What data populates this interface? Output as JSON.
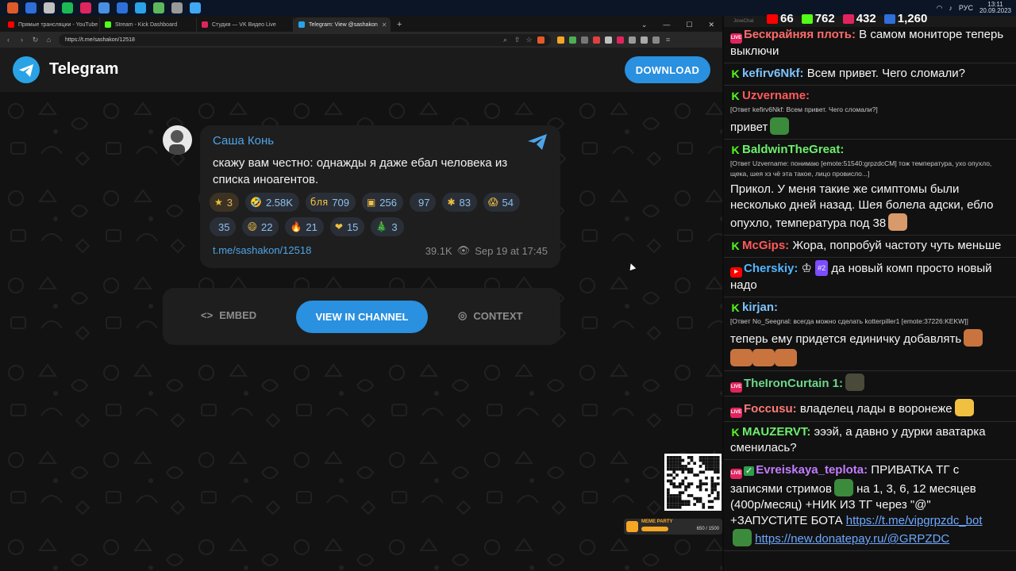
{
  "taskbar": {
    "apps": [
      "#e05a2a",
      "#2e6fd8",
      "#c0c0c0",
      "#1db954",
      "#e0245e",
      "#4a90e2",
      "#2e6fd8",
      "#2aa3e6",
      "#5cb85c",
      "#999999",
      "#3fa9f5"
    ],
    "lang": "РУС",
    "time": "13:11",
    "date": "20.09.2023"
  },
  "browser": {
    "tabs": [
      {
        "label": "Прямые трансляции - YouTube Stu",
        "color": "#ff0000"
      },
      {
        "label": "Stream - Kick Dashboard",
        "color": "#53fc18"
      },
      {
        "label": "Студия — VK Видео Live",
        "color": "#e0245e"
      },
      {
        "label": "Telegram: View @sashakon",
        "color": "#2aa3e6",
        "active": true
      }
    ],
    "new_tab": "+",
    "url": "https://t.me/sashakon/12518"
  },
  "telegram": {
    "brand": "Telegram",
    "download": "DOWNLOAD",
    "post": {
      "author": "Саша Конь",
      "text": "скажу вам честно: однажды я даже ебал человека из списка иноагентов.",
      "reactions": [
        {
          "emoji": "★",
          "count": "3",
          "own": true
        },
        {
          "emoji": "🤣",
          "count": "2.58K"
        },
        {
          "emoji": "бля",
          "count": "709"
        },
        {
          "emoji": "▣",
          "count": "256"
        },
        {
          "emoji": "",
          "count": "97"
        },
        {
          "emoji": "✱",
          "count": "83"
        },
        {
          "emoji": "😱",
          "count": "54"
        },
        {
          "emoji": "",
          "count": "35"
        },
        {
          "emoji": "😄",
          "count": "22"
        },
        {
          "emoji": "🔥",
          "count": "21"
        },
        {
          "emoji": "❤",
          "count": "15"
        },
        {
          "emoji": "🎄",
          "count": "3"
        }
      ],
      "link": "t.me/sashakon/12518",
      "views": "39.1K",
      "date": "Sep 19 at 17:45"
    },
    "actions": {
      "embed": "EMBED",
      "view": "VIEW IN CHANNEL",
      "context": "CONTEXT"
    }
  },
  "overlay": {
    "meme_label": "МЕМЕ PARTY",
    "meme_count": "650 / 1500",
    "meme_progress": 0.43
  },
  "chat": {
    "window_title": "JoveChat",
    "stats": [
      {
        "platform": "youtube",
        "value": "66",
        "color": "#ff0000"
      },
      {
        "platform": "kick",
        "value": "762",
        "color": "#53fc18"
      },
      {
        "platform": "vk",
        "value": "432",
        "color": "#e0245e"
      },
      {
        "platform": "viewers",
        "value": "1,260",
        "color": "#2e6fd8"
      }
    ],
    "messages": [
      {
        "plat": "vk",
        "nick": "Бескрайняя плоть:",
        "color": "#ff6b6b",
        "text": "В самом мониторе теперь выключи"
      },
      {
        "plat": "kick",
        "nick": "kefirv6Nkf:",
        "color": "#7cc4ff",
        "text": "Всем привет. Чего сломали?"
      },
      {
        "plat": "kick",
        "nick": "Uzvername:",
        "color": "#ff5a5a",
        "reply": "[Ответ kefirv6Nkf: Всем привет. Чего сломали?]",
        "text": "привет",
        "emote": "#3c8a3c"
      },
      {
        "plat": "kick",
        "nick": "BaldwinTheGreat:",
        "color": "#6cf06c",
        "reply": "[Ответ Uzvername: понимаю [emote:51540:grpzdcCM] тож температура, ухо опухло, щека, шея хз чё эта такое, лицо провисло...]",
        "text": "Прикол. У меня такие же симптомы были несколько дней назад. Шея болела адски, ебло опухло, температура под 38",
        "emote": "#d89a6a"
      },
      {
        "plat": "kick",
        "nick": "McGips:",
        "color": "#ff5a5a",
        "text": "Жора, попробуй частоту чуть меньше"
      },
      {
        "plat": "yt",
        "nick": "Cherskiy:",
        "color": "#52b6ff",
        "badge": "#2",
        "crown": "♔",
        "text": "да новый комп просто новый надо"
      },
      {
        "plat": "kick",
        "nick": "kirjan:",
        "color": "#7cc4ff",
        "reply": "[Ответ No_Seegnal: всегда можно сделать kotterpiller1 [emote:37226:KEKW]]",
        "text": "теперь ему придется единичку добавлять",
        "emote": "#c9743e",
        "emote_row": 3
      },
      {
        "plat": "vk",
        "nick": "TheIronCurtain 1:",
        "color": "#6cd68a",
        "text": "",
        "emote": "#4a4a3a"
      },
      {
        "plat": "vk",
        "nick": "Foccusu:",
        "color": "#ff7a7a",
        "text": "владелец лады в воронеже",
        "emote": "#f0c040"
      },
      {
        "plat": "kick",
        "nick": "MAUZERVT:",
        "color": "#6cf06c",
        "text": "эээй, а давно у дурки аватарка сменилась?"
      },
      {
        "plat": "vk",
        "nick": "Evreiskaya_teplota:",
        "color": "#c47cff",
        "check": "✓",
        "text_a": "ПРИВАТКА ТГ с записями стримов",
        "text_b": "на 1, 3, 6, 12 месяцев (400р/месяц) +НИК ИЗ ТГ через \"@\" +ЗАПУСТИТЕ БОТА",
        "link1": "https://t.me/vipgrpzdc_bot",
        "link2": "https://new.donatepay.ru/@GRPZDC",
        "emote": "#3c8a3c"
      }
    ]
  }
}
